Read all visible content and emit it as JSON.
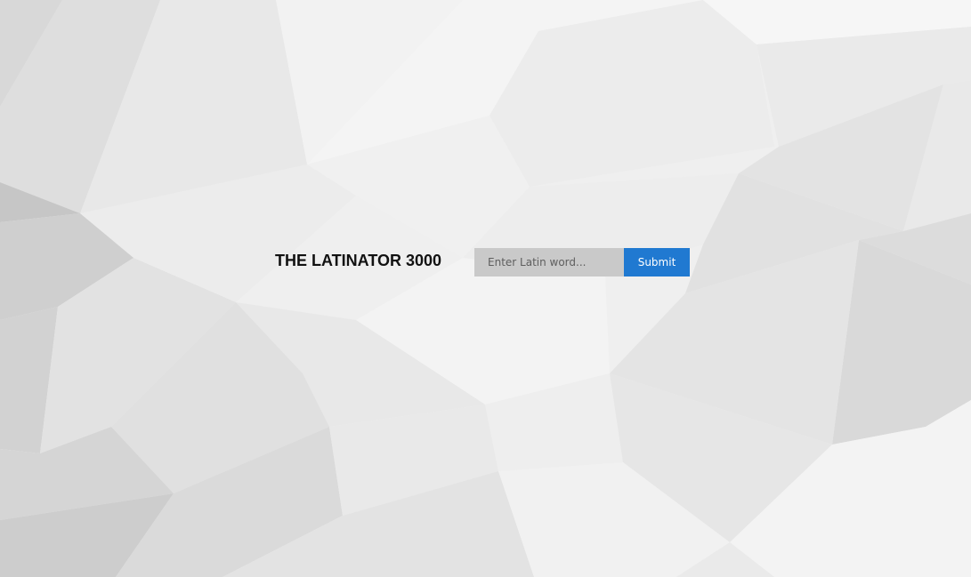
{
  "app": {
    "title": "THE LATINATOR 3000"
  },
  "search": {
    "placeholder": "Enter Latin word...",
    "value": "",
    "submit_label": "Submit"
  },
  "colors": {
    "accent": "#2079d1",
    "input_bg": "#c9c9c9",
    "title_text": "#111111"
  }
}
